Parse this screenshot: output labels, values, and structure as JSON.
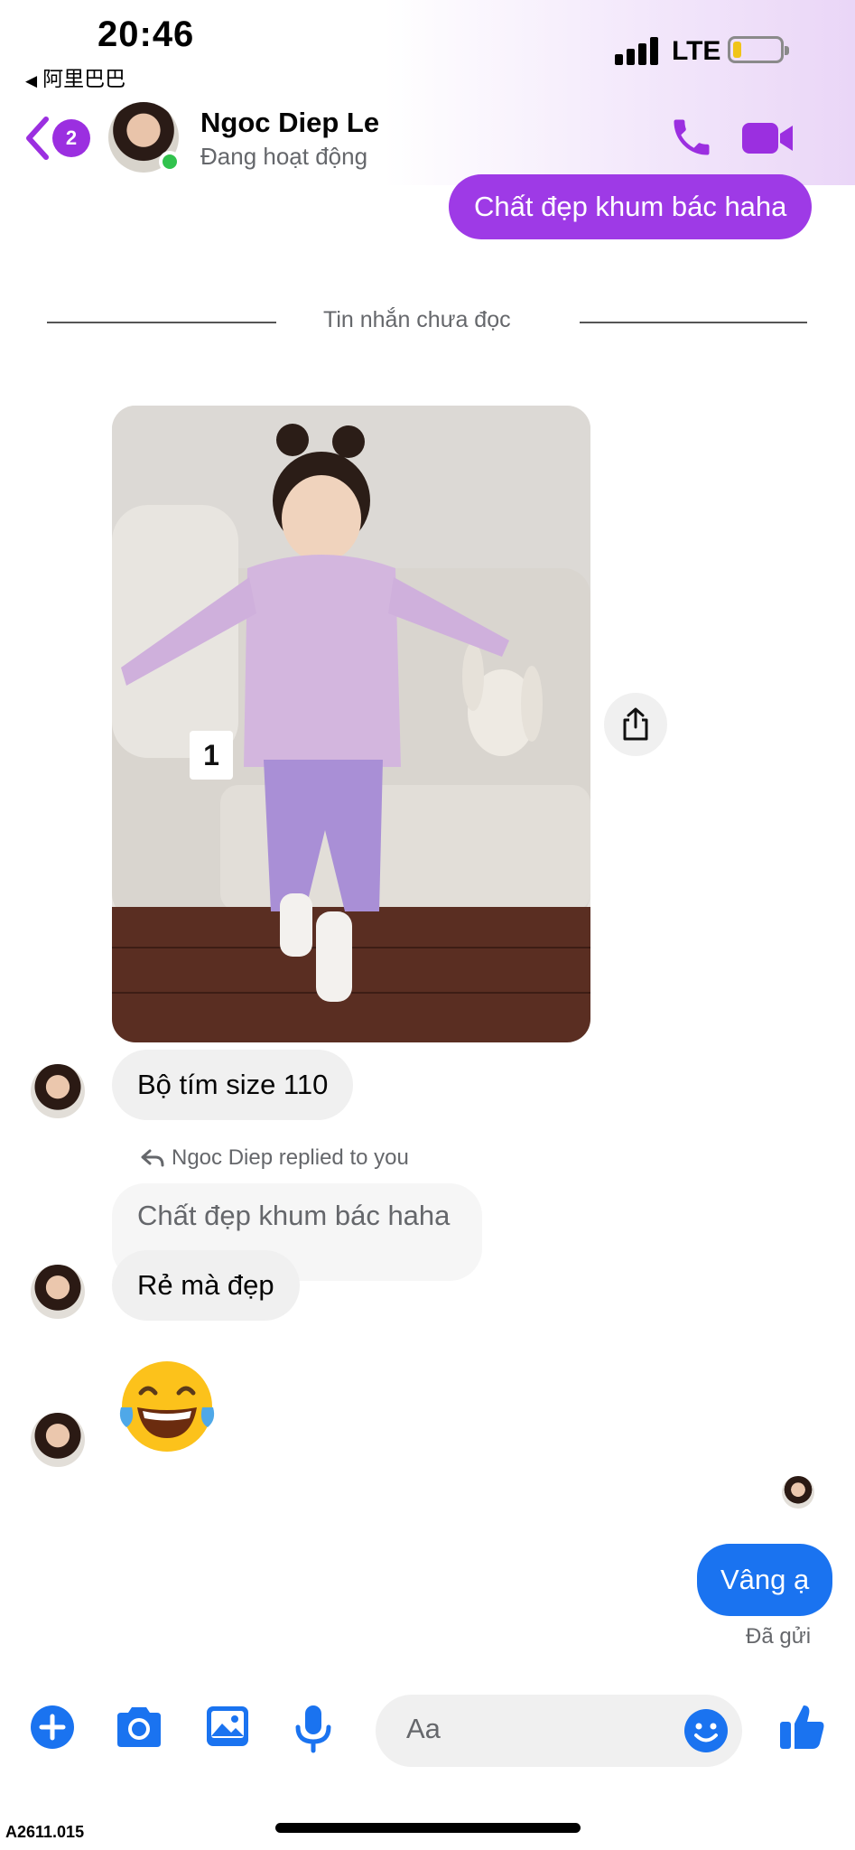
{
  "status_bar": {
    "time": "20:46",
    "back_app_label": "阿里巴巴",
    "network": "LTE"
  },
  "header": {
    "unread_count": "2",
    "contact_name": "Ngoc Diep Le",
    "contact_status": "Đang hoạt động",
    "icons": [
      "chevron-left-icon",
      "phone-icon",
      "video-camera-icon"
    ],
    "accent_color": "#9b2fe0"
  },
  "messages": {
    "outgoing_top": "Chất đẹp khum bác haha",
    "divider": "Tin nhắn chưa đọc",
    "photo_tag": "1",
    "incoming_1": "Bộ tím size 110",
    "reply_note": "Ngoc Diep replied to you",
    "quoted_text": "Chất đẹp khum bác haha",
    "incoming_2": "Rẻ mà đẹp",
    "emoji": "face-with-tears-of-joy",
    "outgoing_last": "Vâng ạ",
    "sent_status": "Đã gửi"
  },
  "composer": {
    "placeholder": "Aa",
    "icons": [
      "plus-icon",
      "camera-icon",
      "image-icon",
      "microphone-icon",
      "smile-icon",
      "thumbs-up-icon"
    ],
    "accent_color": "#1a73f0"
  },
  "watermark": "A2611.015"
}
